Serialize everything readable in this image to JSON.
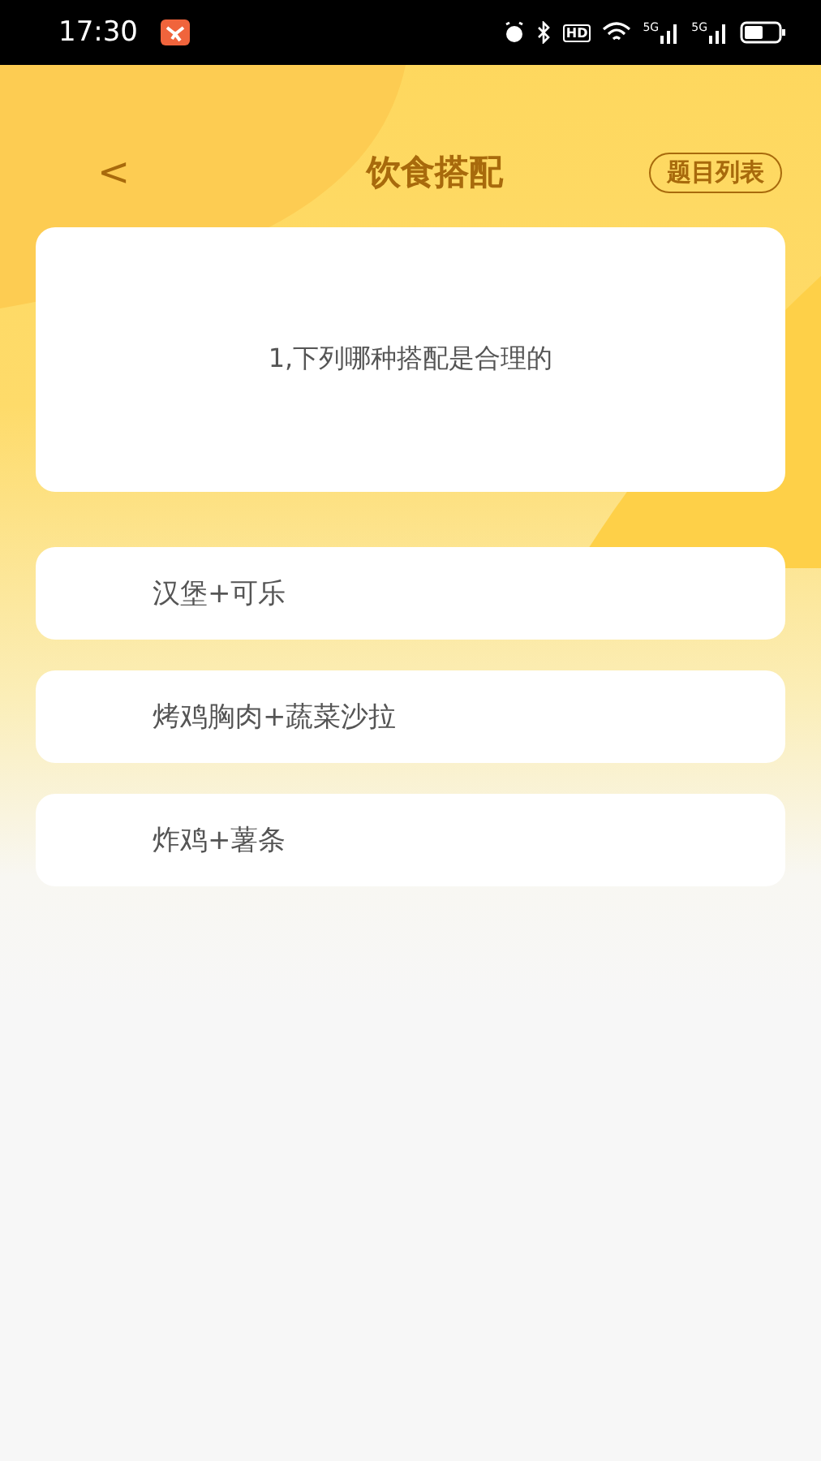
{
  "status_bar": {
    "time": "17:30",
    "hd_label": "HD",
    "signal_labels": [
      "5G",
      "5G"
    ]
  },
  "header": {
    "back": "<",
    "title": "饮食搭配",
    "list_button": "题目列表"
  },
  "question": {
    "text": "1,下列哪种搭配是合理的"
  },
  "options": [
    {
      "label": "汉堡+可乐",
      "selected": false
    },
    {
      "label": "烤鸡胸肉+蔬菜沙拉",
      "selected": false
    },
    {
      "label": "炸鸡+薯条",
      "selected": false
    }
  ]
}
